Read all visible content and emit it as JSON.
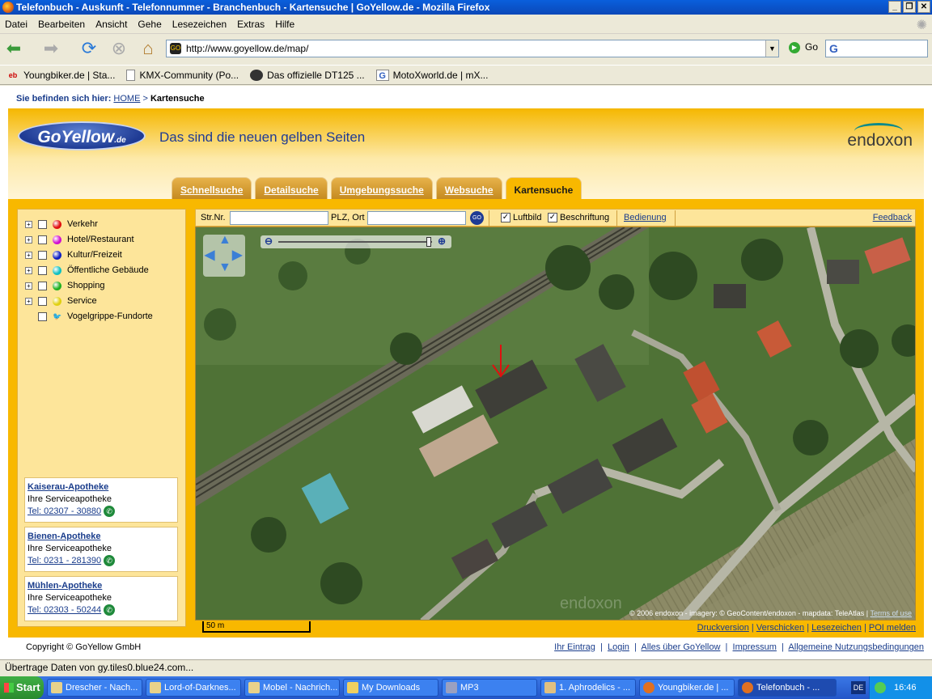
{
  "window": {
    "title": "Telefonbuch - Auskunft - Telefonnummer - Branchenbuch - Kartensuche | GoYellow.de - Mozilla Firefox"
  },
  "menu": [
    "Datei",
    "Bearbeiten",
    "Ansicht",
    "Gehe",
    "Lesezeichen",
    "Extras",
    "Hilfe"
  ],
  "navbar": {
    "url": "http://www.goyellow.de/map/",
    "go_label": "Go",
    "search_engine": "G"
  },
  "bookmarks": [
    {
      "icon": "ebay-icon",
      "label": "Youngbiker.de | Sta..."
    },
    {
      "icon": "page-icon",
      "label": "KMX-Community (Po..."
    },
    {
      "icon": "motorbike-icon",
      "label": "Das offizielle DT125 ..."
    },
    {
      "icon": "google-icon",
      "label": "MotoXworld.de | mX..."
    }
  ],
  "breadcrumb": {
    "label": "Sie befinden sich hier:",
    "home": "HOME",
    "sep": ">",
    "current": "Kartensuche"
  },
  "header": {
    "logo": "GoYellow",
    "logo_suffix": ".de",
    "tagline": "Das sind die neuen gelben Seiten",
    "partner": "endoxon"
  },
  "tabs": [
    {
      "label": "Schnellsuche",
      "active": false
    },
    {
      "label": "Detailsuche",
      "active": false
    },
    {
      "label": "Umgebungssuche",
      "active": false
    },
    {
      "label": "Websuche",
      "active": false
    },
    {
      "label": "Kartensuche",
      "active": true
    }
  ],
  "categories": [
    {
      "label": "Verkehr",
      "color": "#e01010",
      "expandable": true
    },
    {
      "label": "Hotel/Restaurant",
      "color": "#d010d0",
      "expandable": true
    },
    {
      "label": "Kultur/Freizeit",
      "color": "#1020c0",
      "expandable": true
    },
    {
      "label": "Öffentliche Gebäude",
      "color": "#10c0c0",
      "expandable": true
    },
    {
      "label": "Shopping",
      "color": "#20b020",
      "expandable": true
    },
    {
      "label": "Service",
      "color": "#e0d010",
      "expandable": true
    },
    {
      "label": "Vogelgrippe-Fundorte",
      "color": "bird-icon",
      "expandable": false
    }
  ],
  "ads": [
    {
      "name": "Kaiserau-Apotheke",
      "desc": "Ihre Serviceapotheke",
      "tel": "Tel: 02307 - 30880"
    },
    {
      "name": "Bienen-Apotheke",
      "desc": "Ihre Serviceapotheke",
      "tel": "Tel: 0231 - 281390"
    },
    {
      "name": "Mühlen-Apotheke",
      "desc": "Ihre Serviceapotheke",
      "tel": "Tel: 02303 - 50244"
    }
  ],
  "maptoolbar": {
    "street_label": "Str.Nr.",
    "plz_label": "PLZ, Ort",
    "street_value": "",
    "plz_value": "",
    "aerial_label": "Luftbild",
    "aerial_checked": true,
    "labels_label": "Beschriftung",
    "labels_checked": true,
    "help_link": "Bedienung",
    "feedback_link": "Feedback"
  },
  "map": {
    "copyright": "© 2006 endoxon - imagery: © GeoContent/endoxon - mapdata: TeleAtlas |",
    "terms": "Terms of use",
    "watermark": "endoxon",
    "scale": "50 m"
  },
  "bottom_links": [
    "Druckversion",
    "Verschicken",
    "Lesezeichen",
    "POI melden"
  ],
  "footer": {
    "copyright": "Copyright © GoYellow GmbH",
    "links": [
      "Ihr Eintrag",
      "Login",
      "Alles über GoYellow",
      "Impressum",
      "Allgemeine Nutzungsbedingungen"
    ]
  },
  "status": "Übertrage Daten von gy.tiles0.blue24.com...",
  "taskbar": {
    "start": "Start",
    "tasks": [
      {
        "label": "Drescher - Nach...",
        "active": false
      },
      {
        "label": "Lord-of-Darknes...",
        "active": false
      },
      {
        "label": "Mobel - Nachrich...",
        "active": false
      },
      {
        "label": "My Downloads",
        "active": false
      },
      {
        "label": "MP3",
        "active": false
      },
      {
        "label": "1. Aphrodelics - ...",
        "active": false
      },
      {
        "label": "Youngbiker.de | ...",
        "active": false
      },
      {
        "label": "Telefonbuch - ...",
        "active": true
      }
    ],
    "lang": "DE",
    "tray_expand": "«",
    "clock": "16:46"
  }
}
